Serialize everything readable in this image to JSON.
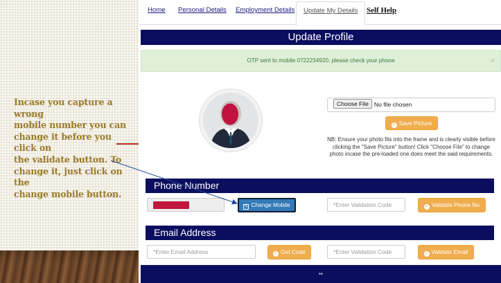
{
  "slide": {
    "callout_lines": [
      "Incase you capture a wrong",
      "mobile number you can",
      "change it before you click on",
      "the validate button. To",
      "change it, just click on the",
      "change mobile button."
    ]
  },
  "nav": {
    "tabs": [
      {
        "label": "Home",
        "key": "home"
      },
      {
        "label": "Personal Details",
        "key": "personal"
      },
      {
        "label": "Employment Details",
        "key": "employment"
      },
      {
        "label": "Update My Details",
        "key": "update",
        "active": true
      },
      {
        "label": "Self Help",
        "key": "selfhelp"
      }
    ]
  },
  "page": {
    "title": "Update Profile",
    "alert": "OTP sent to mobile 0722234920. please check your phone",
    "alert_close": "×"
  },
  "photo": {
    "choose_file_label": "Choose File",
    "no_file_text": "No file chosen",
    "save_picture_label": "Save Picture",
    "note": "NB: Ensure your photo fits into the frame and is clearly visible before clicking the \"Save Picture\" button! Click \"Choose File\" to change photo incase the pre-loaded one does meet the said requirements."
  },
  "phone_section": {
    "title": "Phone Number",
    "change_mobile_label": "Change Mobile",
    "validation_placeholder": "*Enter Validation Code",
    "validate_label": "Validate Phone No"
  },
  "email_section": {
    "title": "Email Address",
    "email_placeholder": "*Enter Email Address",
    "get_code_label": "Get Code",
    "validation_placeholder": "*Enter Validation Code",
    "validate_label": "Validate Email"
  },
  "footer": {
    "text": "**"
  },
  "colors": {
    "navy_bar": "#0b0d5e",
    "alert_bg": "#dff0d8",
    "orange_button": "#f0ad4e",
    "blue_button": "#337ab7",
    "callout_text": "#9b7a2a",
    "redaction": "#c0163b"
  },
  "icons": {
    "save": "check-circle-icon",
    "change_mobile": "edit-icon",
    "validate": "check-circle-icon",
    "get_code": "check-circle-icon"
  }
}
